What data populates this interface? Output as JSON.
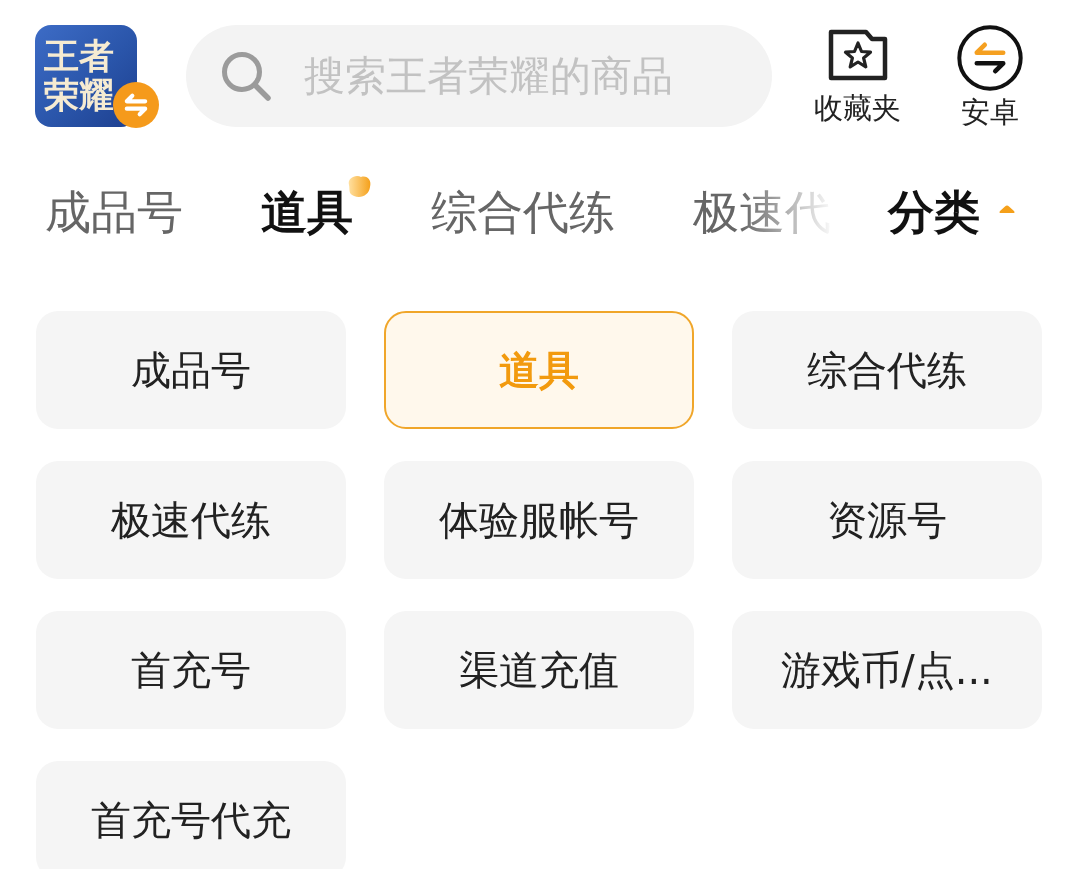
{
  "header": {
    "logo": {
      "lines": [
        "王者",
        "荣耀"
      ]
    },
    "search": {
      "placeholder": "搜索王者荣耀的商品"
    },
    "actions": [
      {
        "kind": "favorites",
        "label": "收藏夹"
      },
      {
        "kind": "platform",
        "label": "安卓"
      }
    ]
  },
  "tabs": [
    {
      "label": "成品号",
      "selected": false
    },
    {
      "label": "道具",
      "selected": true
    },
    {
      "label": "综合代练",
      "selected": false
    },
    {
      "label": "极速代",
      "selected": false
    }
  ],
  "category_toggle": {
    "label": "分类",
    "expanded": true
  },
  "categories": [
    {
      "label": "成品号",
      "selected": false
    },
    {
      "label": "道具",
      "selected": true
    },
    {
      "label": "综合代练",
      "selected": false
    },
    {
      "label": "极速代练",
      "selected": false
    },
    {
      "label": "体验服帐号",
      "selected": false
    },
    {
      "label": "资源号",
      "selected": false
    },
    {
      "label": "首充号",
      "selected": false
    },
    {
      "label": "渠道充值",
      "selected": false
    },
    {
      "label": "游戏币/点...",
      "selected": false
    },
    {
      "label": "首充号代充",
      "selected": false
    }
  ]
}
